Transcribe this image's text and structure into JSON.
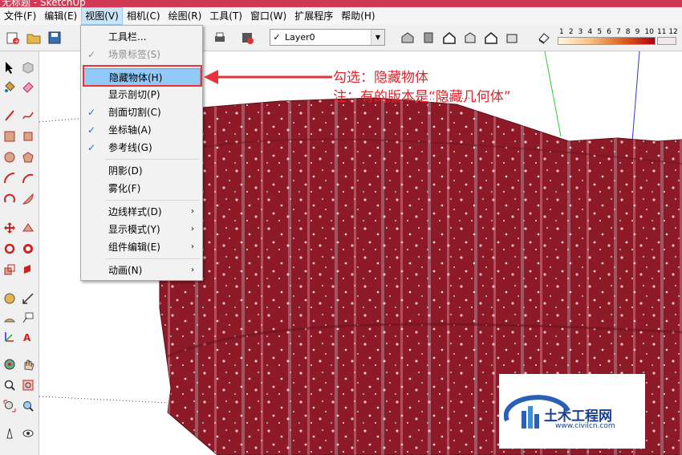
{
  "window": {
    "title": "无标题 - SketchUp"
  },
  "menubar": {
    "items": [
      "文件(F)",
      "编辑(E)",
      "视图(V)",
      "相机(C)",
      "绘图(R)",
      "工具(T)",
      "窗口(W)",
      "扩展程序",
      "帮助(H)"
    ],
    "active_index": 2
  },
  "toolbar": {
    "layer": {
      "value": "Layer0",
      "checked": true
    },
    "scale_labels": [
      "1",
      "2",
      "3",
      "4",
      "5",
      "6",
      "7",
      "8",
      "9",
      "10"
    ],
    "scale_extra_labels": [
      "11",
      "12"
    ]
  },
  "view_menu": {
    "items": [
      {
        "label": "工具栏...",
        "checked": false,
        "disabled": false,
        "submenu": false,
        "highlighted": false
      },
      {
        "label": "场景标签(S)",
        "checked": true,
        "disabled": true,
        "submenu": false,
        "highlighted": false
      },
      {
        "label": "隐藏物体(H)",
        "checked": false,
        "disabled": false,
        "submenu": false,
        "highlighted": true
      },
      {
        "label": "显示剖切(P)",
        "checked": false,
        "disabled": false,
        "submenu": false,
        "highlighted": false
      },
      {
        "label": "剖面切割(C)",
        "checked": true,
        "disabled": false,
        "submenu": false,
        "highlighted": false
      },
      {
        "label": "坐标轴(A)",
        "checked": true,
        "disabled": false,
        "submenu": false,
        "highlighted": false
      },
      {
        "label": "参考线(G)",
        "checked": true,
        "disabled": false,
        "submenu": false,
        "highlighted": false
      },
      {
        "label": "阴影(D)",
        "checked": false,
        "disabled": false,
        "submenu": false,
        "highlighted": false
      },
      {
        "label": "雾化(F)",
        "checked": false,
        "disabled": false,
        "submenu": false,
        "highlighted": false
      },
      {
        "label": "边线样式(D)",
        "checked": false,
        "disabled": false,
        "submenu": true,
        "highlighted": false
      },
      {
        "label": "显示模式(Y)",
        "checked": false,
        "disabled": false,
        "submenu": true,
        "highlighted": false
      },
      {
        "label": "组件编辑(E)",
        "checked": false,
        "disabled": false,
        "submenu": true,
        "highlighted": false
      },
      {
        "label": "动画(N)",
        "checked": false,
        "disabled": false,
        "submenu": true,
        "highlighted": false
      }
    ]
  },
  "annotation": {
    "line1": "勾选：隐藏物体",
    "line2": "注：有的版本是“隐藏几何体”",
    "color": "#e0242a"
  },
  "watermark": {
    "name": "土木工程网",
    "url": "www.civilcn.com"
  },
  "colors": {
    "model": "#8e1a28",
    "title_bar": "#d13a55",
    "menu_highlight": "#91c9f7",
    "axis_green": "#2ecc2e",
    "axis_blue": "#2a35d8"
  },
  "icons": {
    "check": "✓",
    "submenu_arrow": "›"
  }
}
